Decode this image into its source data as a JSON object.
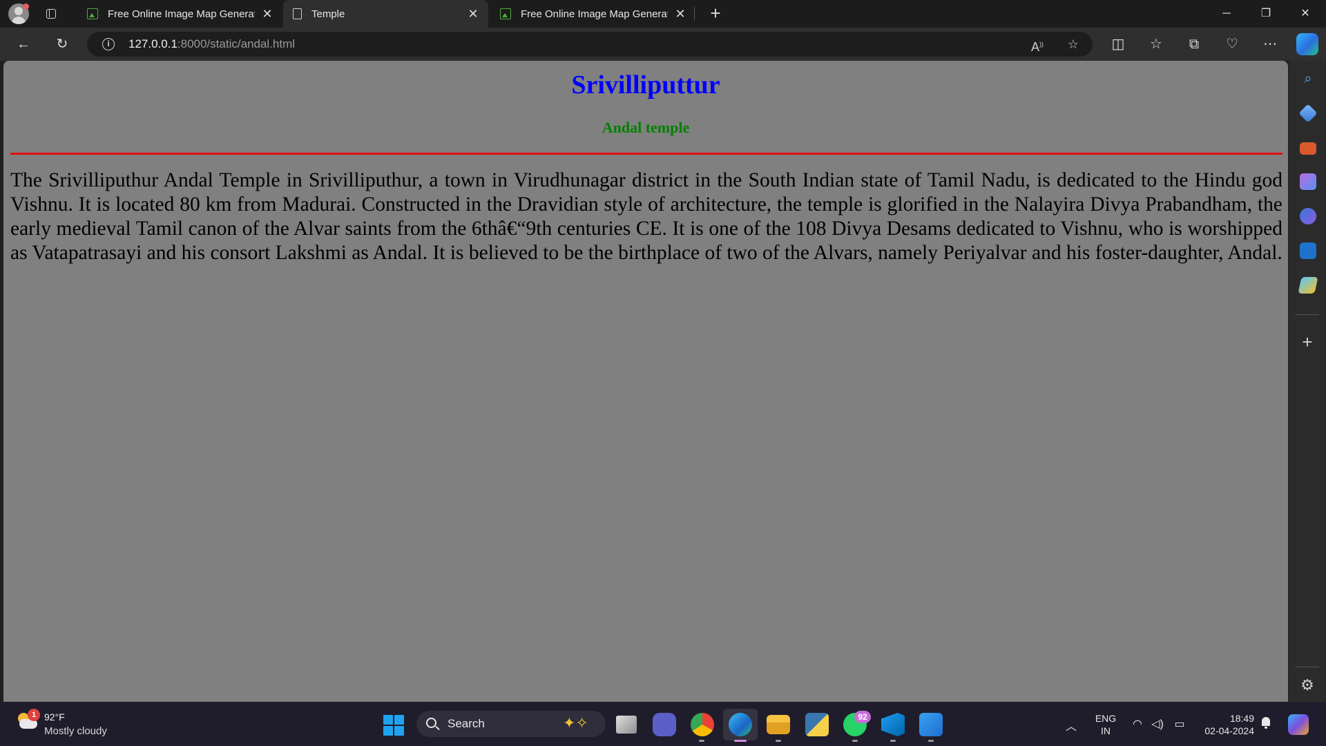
{
  "browser": {
    "tabs": [
      {
        "title": "Free Online Image Map Generator",
        "favicon": "image-favicon-icon",
        "active": false
      },
      {
        "title": "Temple",
        "favicon": "document-favicon-icon",
        "active": true
      },
      {
        "title": "Free Online Image Map Generator",
        "favicon": "image-favicon-icon",
        "active": false
      }
    ],
    "address": {
      "host": "127.0.0.1",
      "rest": ":8000/static/andal.html"
    }
  },
  "page": {
    "title": "Srivilliputtur",
    "subtitle": "Andal temple",
    "body": "The Srivilliputhur Andal Temple in Srivilliputhur, a town in Virudhunagar district in the South Indian state of Tamil Nadu, is dedicated to the Hindu god Vishnu. It is located 80 km from Madurai. Constructed in the Dravidian style of architecture, the temple is glorified in the Nalayira Divya Prabandham, the early medieval Tamil canon of the Alvar saints from the 6thâ€“9th centuries CE. It is one of the 108 Divya Desams dedicated to Vishnu, who is worshipped as Vatapatrasayi and his consort Lakshmi as Andal. It is believed to be the birthplace of two of the Alvars, namely Periyalvar and his foster-daughter, Andal.",
    "colors": {
      "background": "#808080",
      "title": "#0000ff",
      "subtitle": "#008000",
      "rule": "#e01010"
    }
  },
  "taskbar": {
    "weather": {
      "badge": "1",
      "temp": "92°F",
      "desc": "Mostly cloudy"
    },
    "search_label": "Search",
    "whatsapp_badge": "92",
    "language": {
      "line1": "ENG",
      "line2": "IN"
    },
    "clock": {
      "time": "18:49",
      "date": "02-04-2024"
    }
  }
}
